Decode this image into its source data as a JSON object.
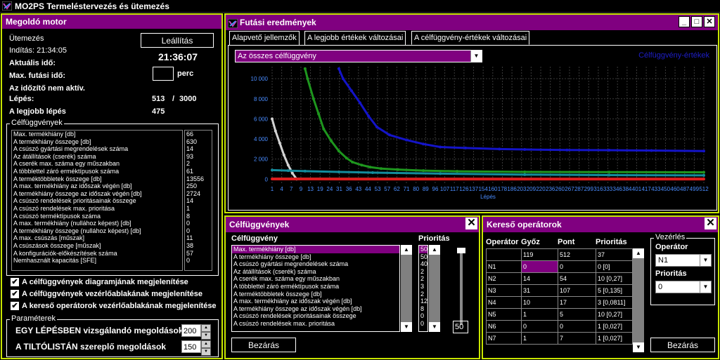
{
  "app": {
    "title": "MO2PS Termeléstervezés és ütemezés"
  },
  "solver": {
    "title": "Megoldó motor",
    "scheduling_label": "Ütemezés",
    "stop_button": "Leállítás",
    "start_label": "Indítás: 21:34:05",
    "current_time": "21:36:07",
    "current_time_label": "Aktuális idő:",
    "max_time_label": "Max. futási idő:",
    "max_time_value": "",
    "max_time_unit": "perc",
    "timer_status": "Az időzítő nem aktív.",
    "steps_label": "Lépés:",
    "steps_current": "513",
    "steps_sep": "/",
    "steps_total": "3000",
    "best_step_label": "A legjobb lépés",
    "best_step_value": "475",
    "objectives_group": "Célfüggvények",
    "objectives": [
      {
        "name": "Max. termékhiány [db]",
        "value": "66"
      },
      {
        "name": "A termékhiány összege [db]",
        "value": "630"
      },
      {
        "name": "A csúszó gyártási megrendelések száma",
        "value": "14"
      },
      {
        "name": "Az átállítások (cserék) száma",
        "value": "93"
      },
      {
        "name": "A cserék max. száma egy műszakban",
        "value": "2"
      },
      {
        "name": "A többlettel záró erméktípusok száma",
        "value": "61"
      },
      {
        "name": "A terméktöbbletek összege [db]",
        "value": "13556"
      },
      {
        "name": "A max. termékhiány az időszak végén [db]",
        "value": "250"
      },
      {
        "name": "A termékhiány összege az időszak végén [db]",
        "value": "2724"
      },
      {
        "name": "A csúszó rendelések prioritásainak összege",
        "value": "14"
      },
      {
        "name": "A csúszó rendelések max. prioritása",
        "value": "1"
      },
      {
        "name": "A csúszó terméktípusok száma",
        "value": "8"
      },
      {
        "name": "A max. termékhiány (nullához képest) [db]",
        "value": "0"
      },
      {
        "name": "A termékhiány összege (nullához képest) [db]",
        "value": "0"
      },
      {
        "name": "A max. csúszás [műszak]",
        "value": "11"
      },
      {
        "name": "A csúszások összege [műszak]",
        "value": "38"
      },
      {
        "name": "A konfigurációk-előkészítések száma",
        "value": "57"
      },
      {
        "name": "Nemhasznált kapacitás [SFE]",
        "value": "0"
      }
    ],
    "checkboxes": [
      {
        "label": "A célfüggvények diagramjának megjelenítése",
        "mark": "✔"
      },
      {
        "label": "A célfüggvények vezérlőablakának megjelenítése",
        "mark": "✔"
      },
      {
        "label": "A kereső operátorok vezérlőablakának megjelenítése",
        "mark": "✔"
      }
    ],
    "params_group": "Paraméterek",
    "param1_label": "EGY LÉPÉSBEN vizsgálandó megoldások",
    "param1_value": "200",
    "param2_label": "A TILTÓLISTÁN szereplő megoldások",
    "param2_value": "150"
  },
  "results": {
    "title": "Futási eredmények",
    "tabs": [
      "Alapvető jellemzők",
      "A legjobb értékek változásai",
      "A célfüggvény-értékek változásai"
    ],
    "combo_value": "Az összes célfüggvény",
    "legend": "Célfüggvény-értékek"
  },
  "chart_data": {
    "type": "line",
    "xlabel": "Lépés",
    "ylabel": "",
    "x_ticks": [
      "1",
      "4",
      "7",
      "9",
      "13",
      "19",
      "24",
      "31",
      "36",
      "43",
      "44",
      "53",
      "57",
      "62",
      "71",
      "80",
      "89",
      "96",
      "107",
      "117",
      "126",
      "137",
      "154",
      "160",
      "178",
      "186",
      "203",
      "209",
      "220",
      "236",
      "260",
      "267",
      "287",
      "299",
      "316",
      "333",
      "346",
      "384",
      "401",
      "417",
      "433",
      "450",
      "460",
      "487",
      "499",
      "512"
    ],
    "y_ticks": [
      "10 000",
      "8 000",
      "6 000",
      "4 000",
      "2 000",
      "0"
    ],
    "ylim": [
      -400,
      11200
    ],
    "xlim": [
      1,
      512
    ],
    "series": [
      {
        "color": "#1414c8",
        "x": [
          80,
          85,
          95,
          105,
          115,
          125,
          140,
          160,
          180,
          200,
          230,
          270,
          300,
          350,
          400,
          450,
          512
        ],
        "y": [
          11000,
          10000,
          8800,
          7600,
          6300,
          5200,
          4400,
          3900,
          3500,
          3200,
          3100,
          3000,
          2950,
          2900,
          2880,
          2850,
          2800
        ]
      },
      {
        "color": "#1e961e",
        "x": [
          40,
          43,
          50,
          56,
          62,
          71,
          80,
          89,
          96,
          107,
          117,
          130,
          150,
          180,
          220,
          300,
          400,
          512
        ],
        "y": [
          11000,
          10000,
          8000,
          6500,
          5000,
          3800,
          2800,
          2100,
          1700,
          1400,
          1200,
          1050,
          950,
          850,
          780,
          720,
          700,
          680
        ]
      },
      {
        "color": "#d2d2d2",
        "x": [
          1,
          5,
          10,
          15,
          20,
          25,
          30
        ],
        "y": [
          6000,
          4800,
          3600,
          2400,
          1400,
          600,
          0
        ]
      },
      {
        "color": "#148c9c",
        "x": [
          1,
          20,
          40,
          80,
          120,
          200,
          300,
          400,
          512
        ],
        "y": [
          900,
          850,
          800,
          720,
          650,
          550,
          450,
          400,
          380
        ]
      },
      {
        "color": "#dc1e1e",
        "x": [
          1,
          50,
          100,
          200,
          300,
          400,
          512
        ],
        "y": [
          20,
          15,
          10,
          10,
          10,
          10,
          10
        ]
      }
    ]
  },
  "objpanel": {
    "title": "Célfüggvények",
    "col_name": "Célfüggvény",
    "col_priority": "Prioritás",
    "close_button": "Bezárás",
    "slider_value": "50",
    "items": [
      {
        "name": "Max. termékhiány [db]",
        "priority": "50"
      },
      {
        "name": "A termékhiány összege [db]",
        "priority": "50"
      },
      {
        "name": "A csúszó gyártási megrendelések száma",
        "priority": "40"
      },
      {
        "name": "Az átállítások (cserék) száma",
        "priority": "2"
      },
      {
        "name": "A cserék max. száma egy műszakban",
        "priority": "2"
      },
      {
        "name": "A többlettel záró erméktípusok száma",
        "priority": "3"
      },
      {
        "name": "A terméktöbbletek összege [db]",
        "priority": "2"
      },
      {
        "name": "A max. termékhiány az időszak végén [db]",
        "priority": "12"
      },
      {
        "name": "A termékhiány összege az időszak végén [db]",
        "priority": "8"
      },
      {
        "name": "A csúszó rendelések prioritásainak összege",
        "priority": "0"
      },
      {
        "name": "A csúszó rendelések max. prioritása",
        "priority": "0"
      }
    ]
  },
  "oppanel": {
    "title": "Kereső operátorok",
    "headers": [
      "Operátor",
      "Győz",
      "Pont",
      "Prioritás"
    ],
    "rows": [
      [
        "",
        "119",
        "512",
        "37"
      ],
      [
        "N1",
        "0",
        "0",
        "0 [0]"
      ],
      [
        "N2",
        "14",
        "54",
        "10 [0,27]"
      ],
      [
        "N3",
        "31",
        "107",
        "5 [0,135]"
      ],
      [
        "N4",
        "10",
        "17",
        "3 [0,0811]"
      ],
      [
        "N5",
        "1",
        "5",
        "10 [0,27]"
      ],
      [
        "N6",
        "0",
        "0",
        "1 [0,027]"
      ],
      [
        "N7",
        "1",
        "7",
        "1 [0,027]"
      ]
    ],
    "control_group": "Vezérlés",
    "operator_label": "Operátor",
    "operator_value": "N1",
    "priority_label": "Prioritás",
    "priority_value": "0",
    "close_button": "Bezárás"
  }
}
